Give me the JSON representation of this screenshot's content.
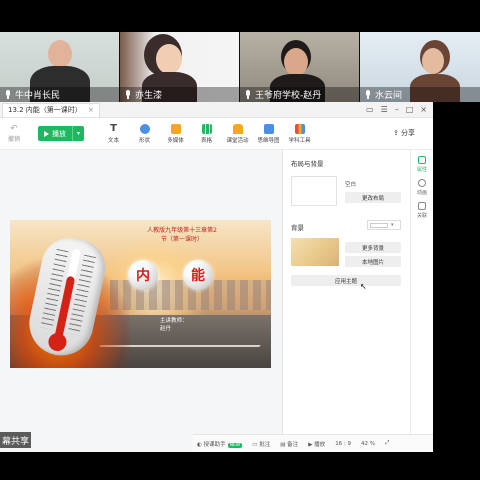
{
  "participants": [
    {
      "name": "牛中肖长民",
      "colors": {
        "bg": "#cfd8d4",
        "head": "#e1b39a",
        "body": "#2d2d2d"
      }
    },
    {
      "name": "亦生漆",
      "colors": {
        "bg": "#f1f1f1",
        "head": "#f0cdb3",
        "body": "#3a2c2a"
      }
    },
    {
      "name": "王爷府学校-赵丹",
      "colors": {
        "bg": "#a6a195",
        "head": "#d9a88a",
        "body": "#1f1b1b"
      }
    },
    {
      "name": "水云间",
      "colors": {
        "bg": "#d6e3ec",
        "head": "#e5bba0",
        "body": "#6a4536"
      }
    }
  ],
  "app": {
    "doc_tab_title": "13.2 内能（第一课时）",
    "undo_label": "撤销",
    "play_label": "播放",
    "play_dropdown_glyph": "▾",
    "share_label": "分享",
    "tools": [
      {
        "label": "文本",
        "icon": "text-icon",
        "color": "#444"
      },
      {
        "label": "形状",
        "icon": "shape-icon",
        "color": "#4a90e2"
      },
      {
        "label": "多媒体",
        "icon": "media-icon",
        "color": "#f5a623"
      },
      {
        "label": "表格",
        "icon": "table-icon",
        "color": "#1fb860"
      },
      {
        "label": "课堂活动",
        "icon": "activity-icon",
        "color": "#f5a623"
      },
      {
        "label": "思维导图",
        "icon": "mindmap-icon",
        "color": "#4a90e2"
      },
      {
        "label": "学科工具",
        "icon": "subject-tools-icon",
        "color": "#e74c3c"
      }
    ]
  },
  "slide": {
    "title_line1": "人教版九年级第十三章第2",
    "title_line2": "节（第一课时）",
    "orb1": "内",
    "orb2": "能",
    "sub_line1": "主讲教师：",
    "sub_line2": "赵丹"
  },
  "panel": {
    "title": "布局与背景",
    "layout_name": "空白",
    "change_layout": "更改布局",
    "bg_label": "背景",
    "more_bg": "更多背景",
    "local_image": "本地图片",
    "apply_theme": "应用主题"
  },
  "rail": [
    {
      "label": "属性",
      "active": true
    },
    {
      "label": "动画",
      "active": false
    },
    {
      "label": "关联",
      "active": false
    }
  ],
  "status": {
    "assistant": "授课助手",
    "badge": "NEW",
    "annotate": "批注",
    "notes": "备注",
    "play": "播放",
    "ratio": "16 : 9",
    "zoom": "42 %"
  },
  "share_text": "幕共享"
}
